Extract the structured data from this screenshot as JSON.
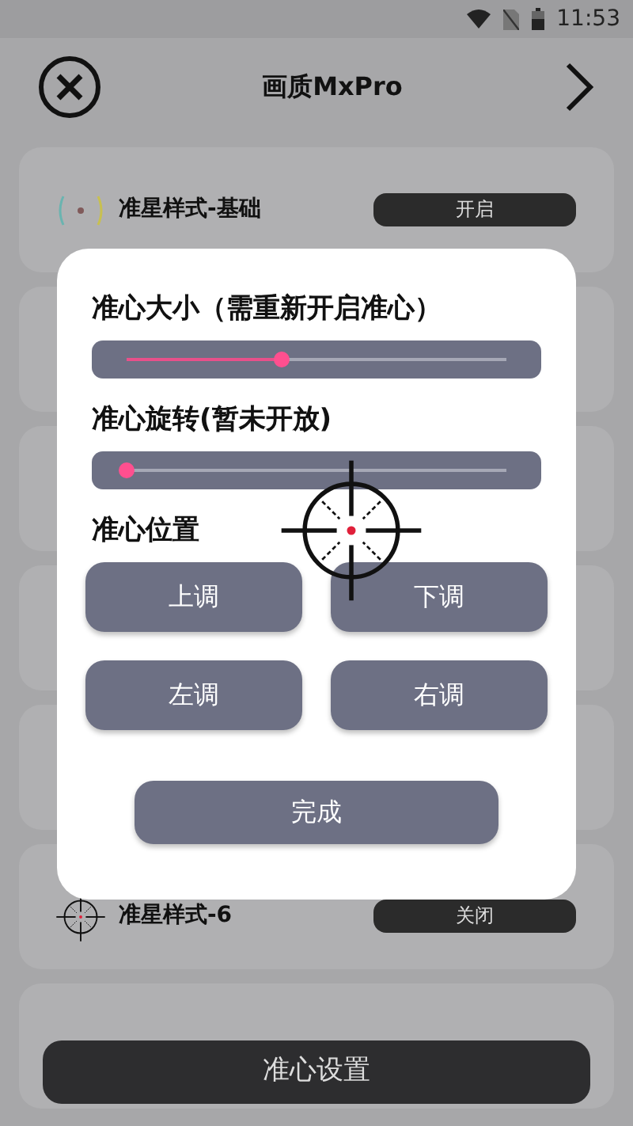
{
  "status_bar": {
    "time": "11:53"
  },
  "header": {
    "title": "画质MxPro"
  },
  "styles": [
    {
      "kind": "item",
      "title": "准星样式-基础",
      "toggle": "开启"
    },
    {
      "kind": "blank"
    },
    {
      "kind": "blank"
    },
    {
      "kind": "blank"
    },
    {
      "kind": "blank"
    },
    {
      "kind": "item",
      "title": "准星样式-6",
      "toggle": "关闭"
    },
    {
      "kind": "blank"
    }
  ],
  "dialog": {
    "sliders": [
      {
        "label": "准心大小（需重新开启准心）",
        "level": 0.41
      },
      {
        "label": "准心旋转(暂未开放)",
        "level": 0
      }
    ],
    "position_label": "准心位置",
    "buttons": [
      "上调",
      "下调",
      "左调",
      "右调"
    ],
    "done": "完成"
  },
  "bottom_button": "准心设置"
}
